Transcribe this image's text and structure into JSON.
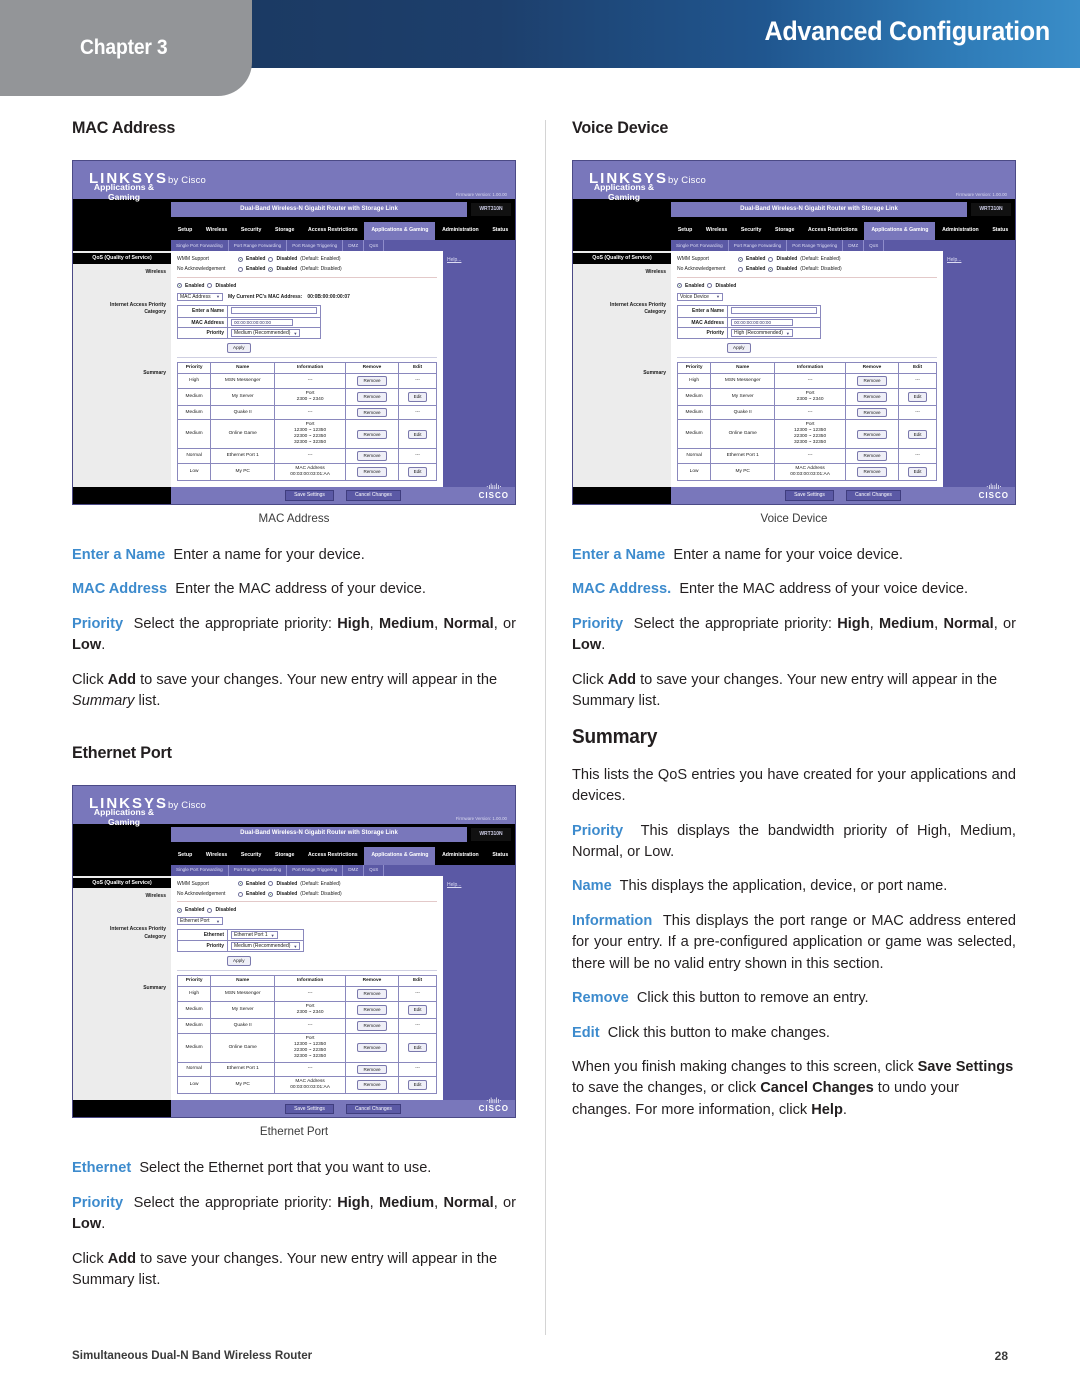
{
  "header": {
    "chapter": "Chapter 3",
    "title": "Advanced Configuration",
    "accent_blue": "#1d3f6c",
    "accent_gray": "#939598"
  },
  "footer": {
    "product": "Simultaneous Dual-N Band Wireless Router",
    "page_number": "28"
  },
  "left_column": {
    "section1_heading": "MAC Address",
    "figure1_caption": "MAC Address",
    "p1_term": "Enter a Name",
    "p1_text": "Enter a name for your device.",
    "p2_term": "MAC Address",
    "p2_text": "Enter the MAC address of your device.",
    "p3_term": "Priority",
    "p3_a": "Select the appropriate priority:",
    "p3_high": "High",
    "p3_medium": "Medium",
    "p3_normal": "Normal",
    "p3_or": ", or ",
    "p3_low": "Low",
    "p4_a": "Click ",
    "p4_add": "Add",
    "p4_b": " to save your changes. Your new entry will appear in the ",
    "p4_summary": "Summary",
    "p4_c": " list.",
    "section2_heading": "Ethernet Port",
    "figure2_caption": "Ethernet Port",
    "p5_term": "Ethernet",
    "p5_text": "Select the Ethernet port that you want to use.",
    "p6_term": "Priority",
    "p6_a": "Select the appropriate priority:",
    "p7_a": "Click ",
    "p7_add": "Add",
    "p7_b": " to save your changes. Your new entry will appear in the Summary list."
  },
  "right_column": {
    "section1_heading": "Voice Device",
    "figure1_caption": "Voice Device",
    "p1_term": "Enter a Name",
    "p1_text": "Enter a name for your voice device.",
    "p2_term": "MAC Address.",
    "p2_text": "Enter the MAC address of your voice device.",
    "p3_term": "Priority",
    "p3_a": "Select the appropriate priority:",
    "p3_high": "High",
    "p3_medium": "Medium",
    "p3_normal": "Normal",
    "p3_or": ", or ",
    "p3_low": "Low",
    "p4_a": "Click ",
    "p4_add": "Add",
    "p4_b": " to save your changes. Your new entry will appear in the Summary list.",
    "summary_heading": "Summary",
    "s1_text": "This lists the QoS entries you have created for your applications and devices.",
    "s2_term": "Priority",
    "s2_text": "This displays the bandwidth priority of High, Medium, Normal, or Low.",
    "s3_term": "Name",
    "s3_text": "This displays the application, device, or port name.",
    "s4_term": "Information",
    "s4_text": "This displays the port range or MAC address entered for your entry. If a pre-configured application or game was selected, there will be no valid entry shown in this section.",
    "s5_term": "Remove",
    "s5_text": "Click this button to remove an entry.",
    "s6_term": "Edit",
    "s6_text": "Click this button to make changes.",
    "s7_a": "When you finish making changes to this screen, click ",
    "s7_save": "Save Settings",
    "s7_b": " to save the changes, or click ",
    "s7_cancel": "Cancel Changes",
    "s7_c": " to undo your changes. For more information, click ",
    "s7_help": "Help",
    "s7_d": "."
  },
  "router_ui": {
    "logo": "LINKSYS",
    "logo_by": "by Cisco",
    "firmware": "Firmware Version: 1.00.00",
    "model_strip": "Dual-Band Wireless-N Gigabit Router with Storage Link",
    "model_number": "WRT310N",
    "app_name": "Applications & Gaming",
    "tabs": [
      "Setup",
      "Wireless",
      "Security",
      "Storage",
      "Access Restrictions",
      "Applications & Gaming",
      "Administration",
      "Status"
    ],
    "active_tab": "Applications & Gaming",
    "subtabs": [
      "Single Port Forwarding",
      "Port Range Forwarding",
      "Port Range Triggering",
      "DMZ",
      "QoS"
    ],
    "side_title": "QoS (Quality of Service)",
    "side_labels": [
      "Wireless",
      "Internet Access Priority",
      "Category",
      "Summary"
    ],
    "wmm_label": "WMM Support",
    "wmm_enabled": "Enabled",
    "wmm_disabled": "Disabled",
    "wmm_default": "(Default: Enabled)",
    "noack_label": "No Acknowledgement",
    "noack_enabled": "Enabled",
    "noack_disabled": "Disabled",
    "noack_default": "(Default: Disabled)",
    "iap_enabled": "Enabled",
    "iap_disabled": "Disabled",
    "my_mac_label": "My Current PC's MAC Address:",
    "my_mac_value": "00:0B:00:00:00:07",
    "help_link": "Help...",
    "field_name_label": "Enter a Name",
    "field_mac_label": "MAC Address",
    "field_priority_label": "Priority",
    "field_ethernet_label": "Ethernet",
    "mac_value": "00:00:00:00:00:00",
    "apply_button": "Apply",
    "save_button": "Save Settings",
    "cancel_button": "Cancel Changes",
    "cisco_word": "CISCO",
    "variants": {
      "mac_address": {
        "category": "MAC Address",
        "priority": "Medium (Recommended)"
      },
      "voice_device": {
        "category": "Voice Device",
        "priority": "High (Recommended)"
      },
      "ethernet_port": {
        "category": "Ethernet Port",
        "ethernet": "Ethernet Port 1",
        "priority": "Medium (Recommended)"
      }
    },
    "summary_table": {
      "columns": [
        "Priority",
        "Name",
        "Information",
        "Remove",
        "Edit"
      ],
      "rows": [
        {
          "priority": "High",
          "name": "MSN Messenger",
          "information": "---",
          "remove": "Remove",
          "edit": "---"
        },
        {
          "priority": "Medium",
          "name": "My Server",
          "information": "Port\n2300 ~ 2340",
          "remove": "Remove",
          "edit": "Edit"
        },
        {
          "priority": "Medium",
          "name": "Quake II",
          "information": "---",
          "remove": "Remove",
          "edit": "---"
        },
        {
          "priority": "Medium",
          "name": "Online Game",
          "information": "Port\n12300 ~ 12350\n22300 ~ 22350\n32300 ~ 32350",
          "remove": "Remove",
          "edit": "Edit"
        },
        {
          "priority": "Normal",
          "name": "Ethernet Port 1",
          "information": "---",
          "remove": "Remove",
          "edit": "---"
        },
        {
          "priority": "Low",
          "name": "My PC",
          "information": "MAC Address\n00:03:00:03:01:AA",
          "remove": "Remove",
          "edit": "Edit"
        }
      ]
    }
  }
}
